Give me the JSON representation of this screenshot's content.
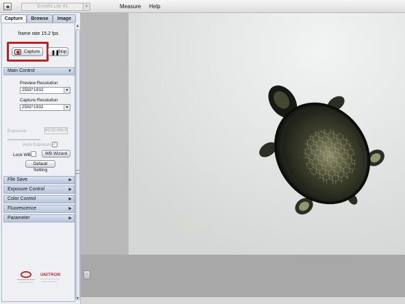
{
  "topbar": {
    "device_select": "Excelis Lite #1",
    "menus": [
      "Measure",
      "Help"
    ]
  },
  "tabs": [
    {
      "label": "Capture",
      "active": true
    },
    {
      "label": "Browse",
      "active": false
    },
    {
      "label": "Image",
      "active": false
    }
  ],
  "capture": {
    "frame_rate": "frame rate 15.2 fps",
    "capture_label": "Capture",
    "stop_label": "Stop"
  },
  "main_control": {
    "title": "Main Control",
    "preview_resolution_label": "Preview Resolution",
    "preview_resolution_value": "2592*1932",
    "capture_resolution_label": "Capture Resolution",
    "capture_resolution_value": "2592*1932",
    "exposure_label": "Exposure",
    "exposure_value": "00:00:006.0",
    "auto_exposure_label": "Auto Exposure",
    "auto_exposure_checked": true,
    "lock_wb_label": "Lock WB",
    "lock_wb_checked": false,
    "wb_wizard_label": "WB Wizard",
    "default_setting_label": "Default Setting"
  },
  "sections": [
    "File Save",
    "Exposure Control",
    "Color Control",
    "Fluorescence",
    "Parameter"
  ],
  "colors": {
    "highlight": "#b8211c",
    "panel_bg": "#eaedf2",
    "section_header": "#c7d1e3",
    "viewer_bg": "#c6c6c6"
  },
  "icons": {
    "app": "camera-app-icon",
    "capture": "camera-icon",
    "stop": "pause-icon",
    "expand": "triangle-down-icon",
    "collapsed": "triangle-right-icon"
  },
  "logos": {
    "right": "UNITRON"
  }
}
